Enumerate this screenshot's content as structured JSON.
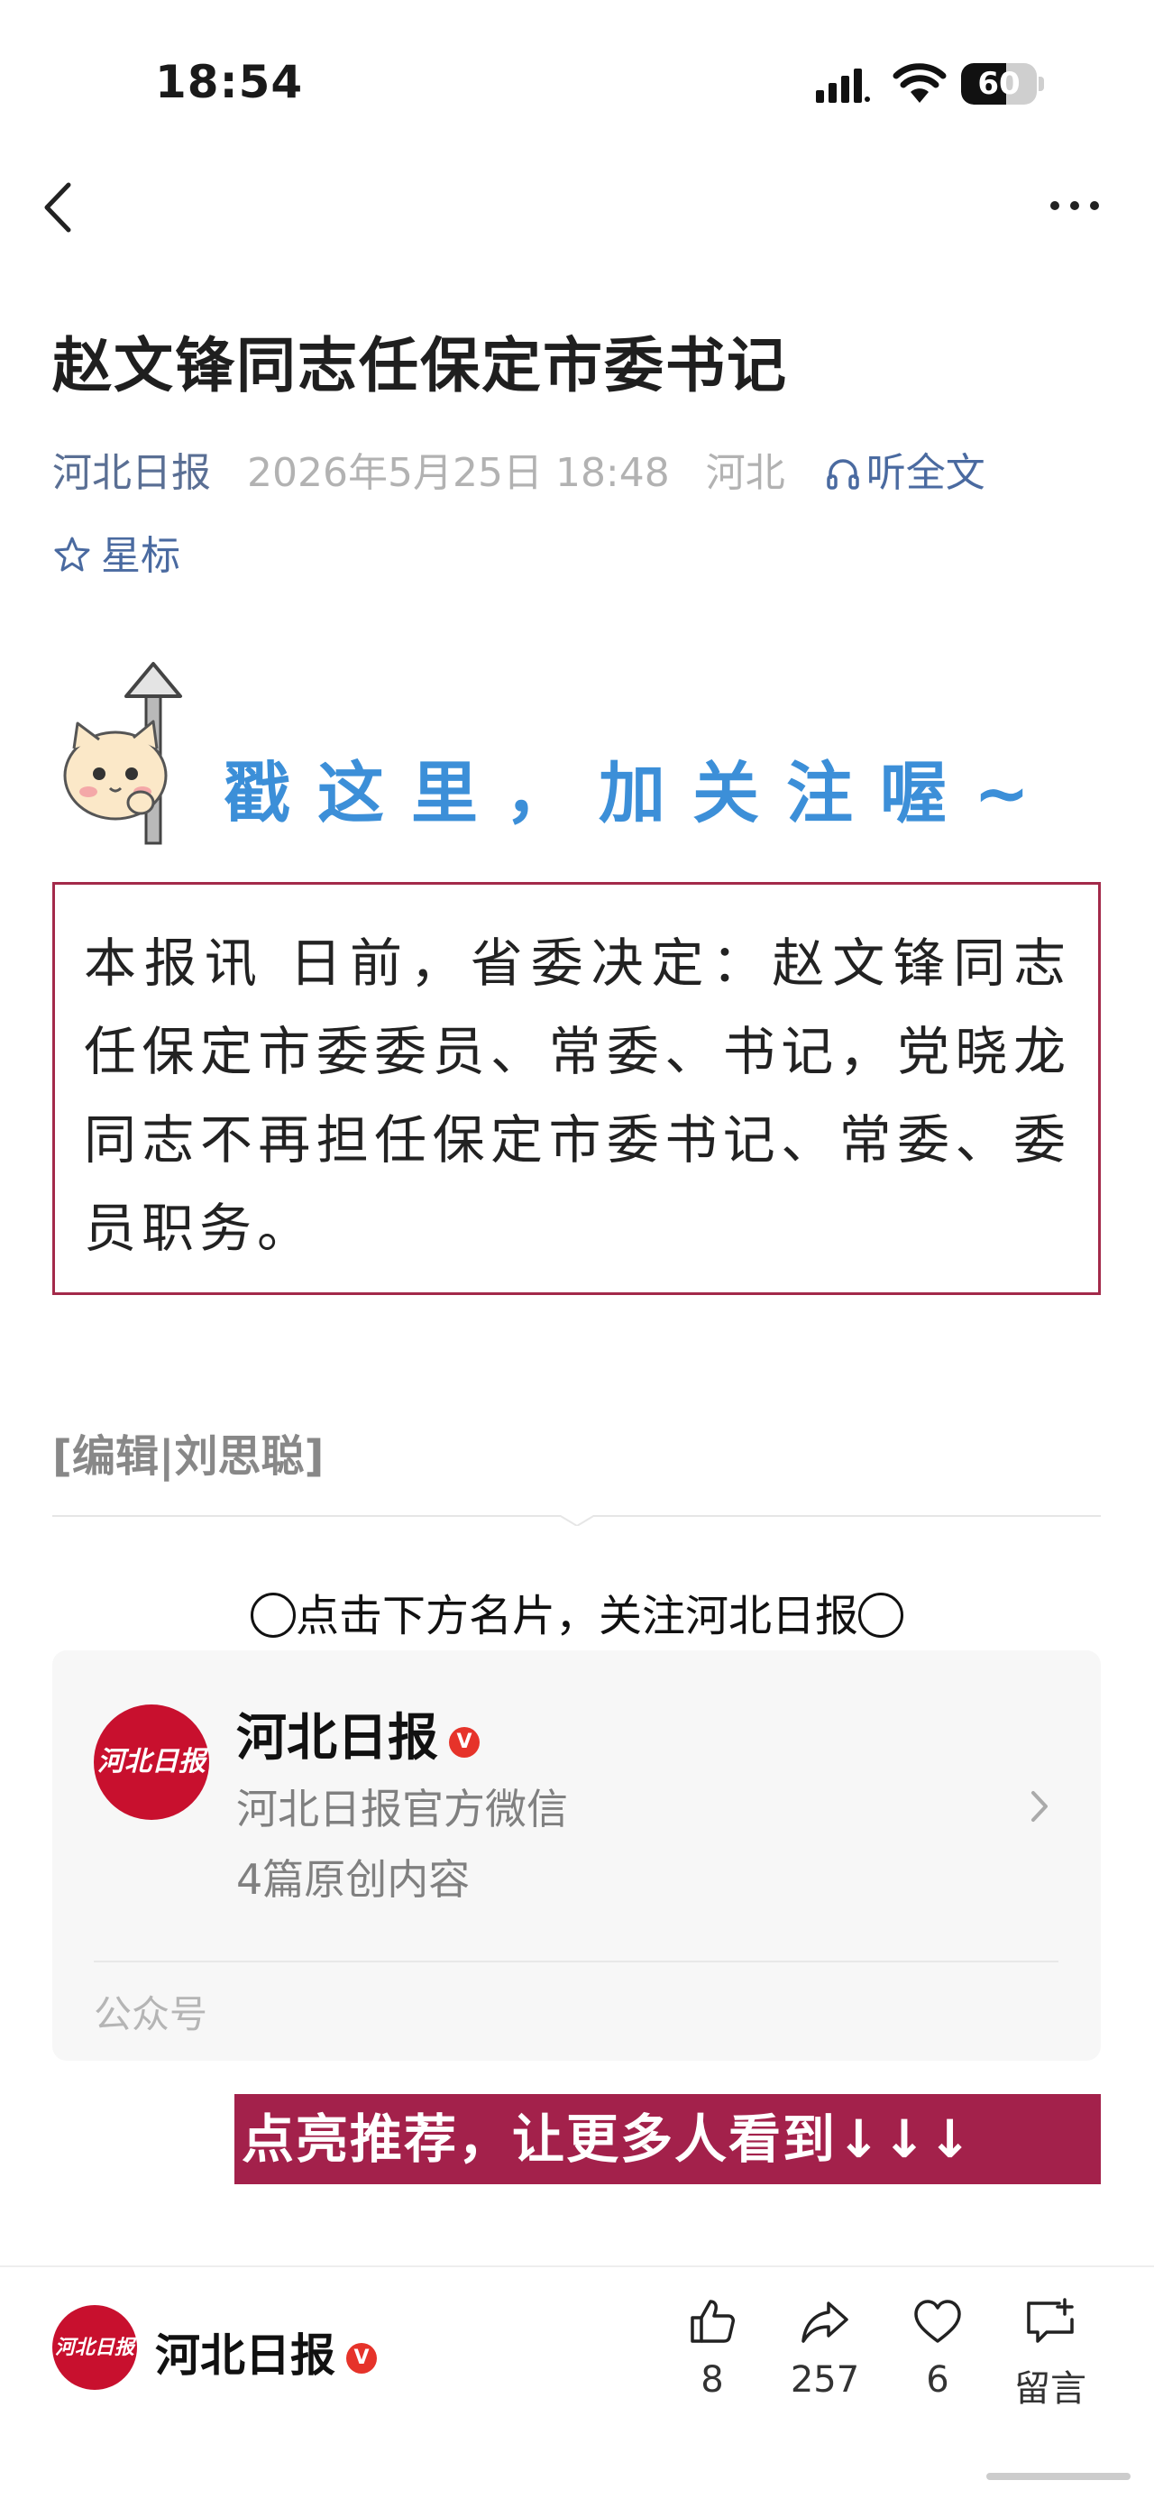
{
  "status_bar": {
    "time": "18:54",
    "battery": "60",
    "battery_level": 0.6
  },
  "article": {
    "title": "赵文锋同志任保定市委书记",
    "source": "河北日报",
    "date": "2026年5月25日 18:48",
    "region": "河北",
    "listen_label": "听全文",
    "star_label": "星标",
    "banner_text": "戳这里，加关注喔~",
    "body": "本报讯 日前，省委决定：赵文锋同志任保定市委委员、常委、书记，党晓龙同志不再担任保定市委书记、常委、委员职务。",
    "editor": "[编辑|刘思聪]",
    "cta_text": "点击下方名片，关注河北日报"
  },
  "account_card": {
    "logo_text": "河北日报",
    "name": "河北日报",
    "verified": "V",
    "description": "河北日报官方微信",
    "original_count": "4篇原创内容",
    "type": "公众号"
  },
  "promo_text": "点亮推荐，让更多人看到↓↓↓",
  "bottom_bar": {
    "logo_text": "河北日报",
    "account_name": "河北日报",
    "verified": "V",
    "like_count": "8",
    "share_count": "257",
    "recommend_count": "6",
    "comment_label": "留言"
  },
  "colors": {
    "accent": "#a3214b",
    "link": "#4a6aa0",
    "brand_red": "#c8102e",
    "banner_blue": "#3c8fd8"
  }
}
